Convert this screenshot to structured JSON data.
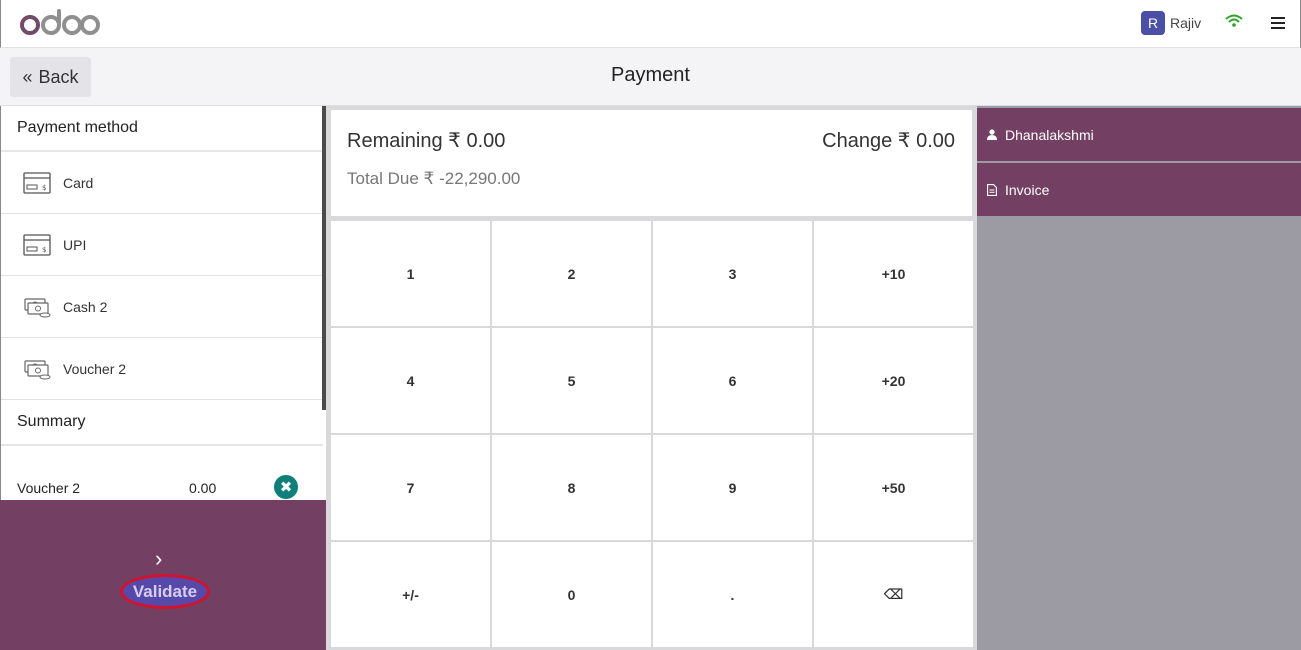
{
  "topbar": {
    "logo_text": "odoo",
    "user_initial": "R",
    "user_name": "Rajiv"
  },
  "subbar": {
    "back_label": "Back",
    "title": "Payment"
  },
  "payment_methods": {
    "heading": "Payment method",
    "items": [
      {
        "label": "Card",
        "icon": "card-icon"
      },
      {
        "label": "UPI",
        "icon": "card-icon"
      },
      {
        "label": "Cash 2",
        "icon": "cash-icon"
      },
      {
        "label": "Voucher 2",
        "icon": "cash-icon"
      }
    ]
  },
  "summary": {
    "heading": "Summary",
    "lines": [
      {
        "label": "Voucher 2",
        "amount": "0.00",
        "remove_icon": "✖"
      }
    ]
  },
  "validate": {
    "arrow": "›",
    "label": "Validate"
  },
  "amounts": {
    "remaining": "Remaining ₹ 0.00",
    "change": "Change ₹ 0.00",
    "total_due": "Total Due  ₹ -22,290.00"
  },
  "keypad": {
    "keys": [
      "1",
      "2",
      "3",
      "+10",
      "4",
      "5",
      "6",
      "+20",
      "7",
      "8",
      "9",
      "+50",
      "+/-",
      "0",
      ".",
      "⌫"
    ]
  },
  "customer": {
    "label": "Dhanalakshmi"
  },
  "invoice": {
    "label": "Invoice"
  },
  "colors": {
    "brand": "#733f62",
    "accent": "#0f7f7a"
  }
}
